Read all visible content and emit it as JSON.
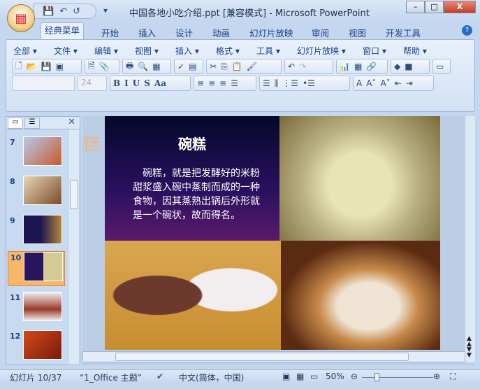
{
  "window": {
    "title": "中国各地小吃介绍.ppt [兼容模式] - Microsoft PowerPoint",
    "minimize": "–",
    "maximize": "□",
    "close": "X"
  },
  "qat": {
    "save": "💾",
    "undo": "↶",
    "redo": "↺",
    "more": "▾"
  },
  "tabs": [
    "经典菜单",
    "开始",
    "插入",
    "设计",
    "动画",
    "幻灯片放映",
    "审阅",
    "视图",
    "开发工具"
  ],
  "help": "?",
  "menus": [
    "全部 ▾",
    "文件 ▾",
    "编辑 ▾",
    "视图 ▾",
    "插入 ▾",
    "格式 ▾",
    "工具 ▾",
    "幻灯片放映 ▾",
    "窗口 ▾",
    "帮助 ▾"
  ],
  "toolbar": {
    "font_size": "24",
    "font_name": "",
    "fmt": [
      "B",
      "I",
      "U",
      "S",
      "Aa"
    ]
  },
  "thumbnails": [
    {
      "n": "7"
    },
    {
      "n": "8"
    },
    {
      "n": "9"
    },
    {
      "n": "10",
      "selected": true
    },
    {
      "n": "11"
    },
    {
      "n": "12"
    }
  ],
  "slide": {
    "title": "碗糕",
    "body": "碗糕，就是把发酵好的米粉甜浆盛入碗中蒸制而成的一种食物，因其蒸熟出锅后外形就是一个碗状，故而得名。",
    "ghost": "糕"
  },
  "status": {
    "slide": "幻灯片 10/37",
    "theme": "“1_Office 主题”",
    "lang": "中文(简体，中国)",
    "zoom": "50%"
  }
}
